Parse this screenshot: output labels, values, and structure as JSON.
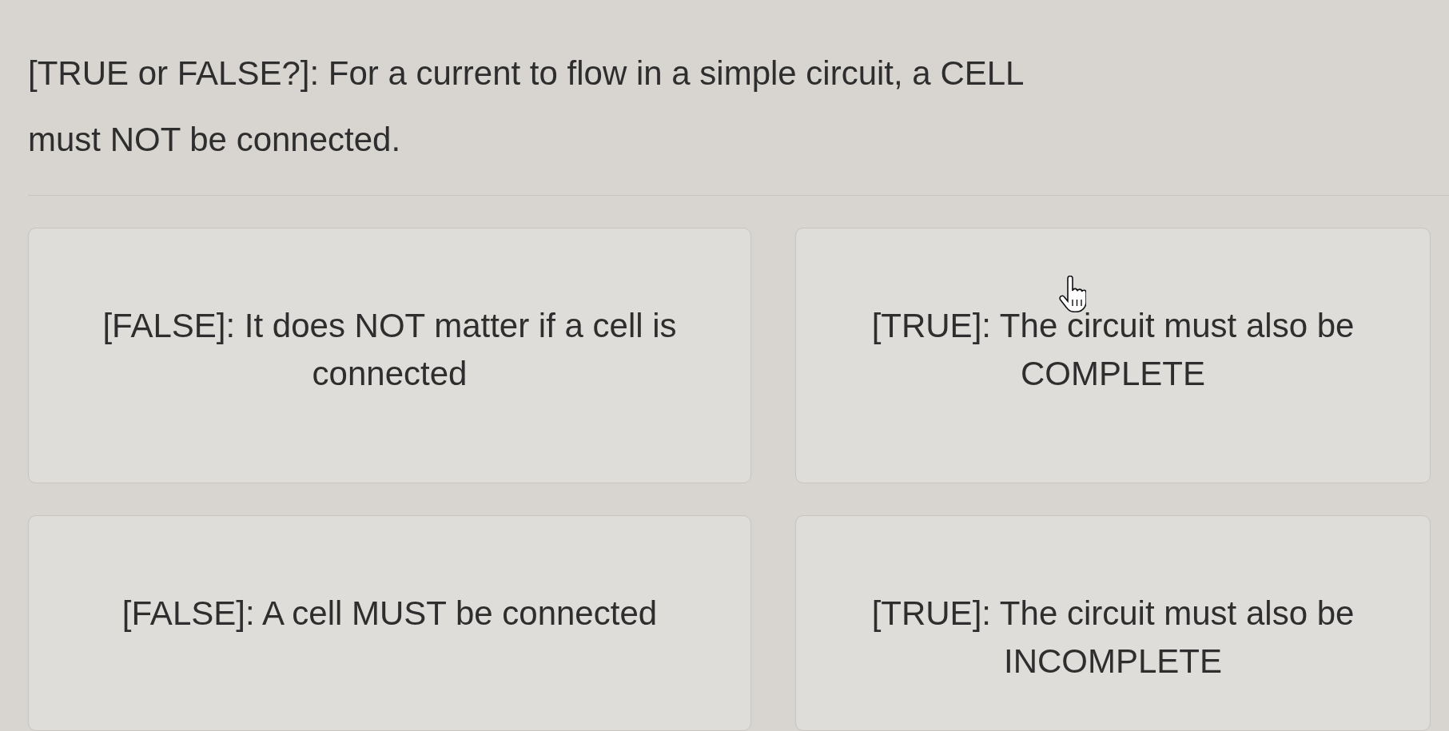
{
  "question": {
    "text": "[TRUE or FALSE?]: For a current to flow in a simple circuit, a CELL must NOT be connected."
  },
  "options": [
    {
      "text": "[FALSE]: It does NOT matter if a cell is connected",
      "hovered": false
    },
    {
      "text": "[TRUE]: The circuit must also be COMPLETE",
      "hovered": true
    },
    {
      "text": "[FALSE]: A cell MUST be connected",
      "hovered": false
    },
    {
      "text": "[TRUE]: The circuit must also be INCOMPLETE",
      "hovered": false
    }
  ]
}
